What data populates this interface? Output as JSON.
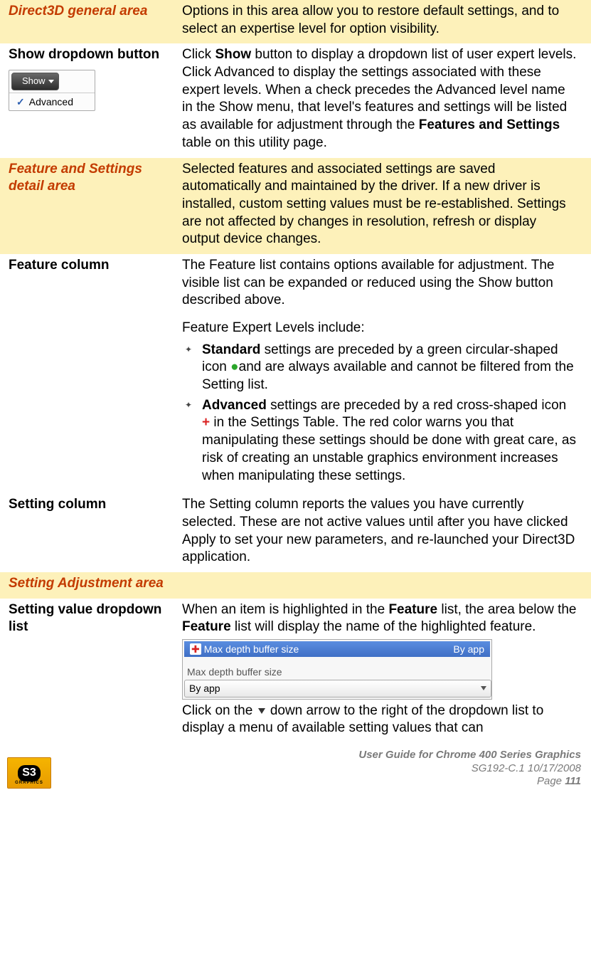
{
  "rows": {
    "r1": {
      "title": "Direct3D general area",
      "desc": "Options in this area allow you to restore default settings, and to select an expertise level for option visibility."
    },
    "r2": {
      "title": "Show dropdown button",
      "show_label": "Show",
      "adv_label": "Advanced",
      "desc_pre": "Click ",
      "desc_bold1": "Show",
      "desc_mid": " button to display a dropdown list of user expert levels. Click Advanced to display the settings associated with these expert levels. When a check precedes the Advanced level name in the Show menu, that level's features and settings will be listed as available for adjustment through the ",
      "desc_bold2": "Features and Settings",
      "desc_post": " table on this utility page."
    },
    "r3": {
      "title": "Feature and Settings detail area",
      "desc": "Selected features and associated settings are saved automatically and maintained by the driver. If a new driver is installed, custom setting values must be re-established. Settings are not affected by changes in resolution, refresh or display output device changes."
    },
    "r4": {
      "title": "Feature column",
      "p1": "The Feature list contains options available for adjustment. The visible list can be expanded or reduced using the Show button described above.",
      "p2": "Feature Expert Levels include:",
      "b1_bold": "Standard",
      "b1_rest": " settings are preceded by a green circular-shaped icon ",
      "b1_tail": "and are always available and cannot be filtered from the Setting list.",
      "b2_bold": "Advanced",
      "b2_rest": " settings are preceded by a red cross-shaped icon ",
      "b2_plus": "+",
      "b2_tail": " in the Settings Table. The red color warns you that manipulating these settings should be done with great care, as risk of creating an unstable graphics environment increases when manipulating these settings."
    },
    "r5": {
      "title": "Setting column",
      "desc": "The Setting column reports the values you have currently selected. These are not active values until after you have clicked Apply to set your new parameters, and re-launched your Direct3D application."
    },
    "r6": {
      "title": "Setting Adjustment area"
    },
    "r7": {
      "title": "Setting value dropdown list",
      "p1_pre": "When an item is highlighted in the ",
      "p1_b1": "Feature",
      "p1_mid": " list, the area below the ",
      "p1_b2": "Feature",
      "p1_post": " list will display the name of the highlighted feature.",
      "sel_name": "Max depth buffer size",
      "sel_val": "By app",
      "sub_label": "Max depth buffer size",
      "dd_val": "By app",
      "p2_pre": "Click on the ",
      "p2_post": "down arrow to the right of the dropdown list to display a menu of available setting values that can"
    }
  },
  "footer": {
    "line1": "User Guide for Chrome 400 Series Graphics",
    "line2": "SG192-C.1   10/17/2008",
    "line3_pre": "Page ",
    "line3_num": "111",
    "logo": "S3"
  }
}
